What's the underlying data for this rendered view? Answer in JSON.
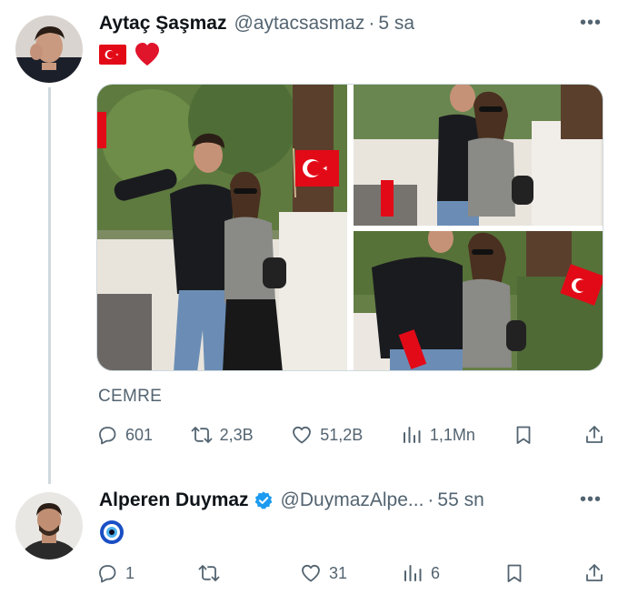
{
  "tweet1": {
    "name": "Aytaç Şaşmaz",
    "handle": "@aytacsasmaz",
    "separator": "·",
    "time": "5 sa",
    "more": "•••",
    "text_emoji": [
      "turkish-flag",
      "red-heart"
    ],
    "sublabel": "CEMRE",
    "actions": {
      "replies": "601",
      "retweets": "2,3B",
      "likes": "51,2B",
      "views": "1,1Mn"
    }
  },
  "tweet2": {
    "name": "Alperen Duymaz",
    "handle": "@DuymazAlpe...",
    "separator": "·",
    "time": "55 sn",
    "more": "•••",
    "verified": true,
    "text_emoji": [
      "nazar-amulet"
    ],
    "actions": {
      "replies": "1",
      "retweets": "",
      "likes": "31",
      "views": "6"
    }
  },
  "colors": {
    "text": "#0f1419",
    "secondary": "#536471",
    "verified": "#1d9bf0",
    "flag_red": "#e30a17",
    "thread_line": "#cfd9de"
  }
}
